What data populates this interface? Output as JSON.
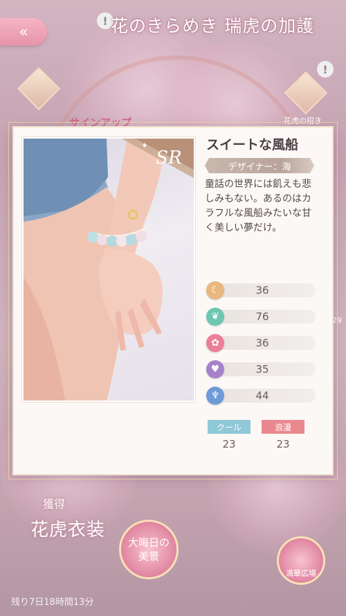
{
  "header": {
    "event_title": "花のきらめき 瑞虎の加護",
    "back_label": "«",
    "alert_glyph": "!"
  },
  "background": {
    "signup_tab": "サインアップ",
    "right_tab": "花虎の招き",
    "bottom_left_title": "花虎衣装",
    "bottom_left_sub": "獲得",
    "center_badge": "大晦日の美景",
    "right_badge": "満華広場",
    "timer": "残り7日18時間13分",
    "side_number": "29"
  },
  "card": {
    "rarity": "SR",
    "name": "スイートな風船",
    "designer": "デザイナー：海",
    "description": "童話の世界には飢えも悲しみもない。あるのはカラフルな風船みたいな甘く美しい夢だけ。",
    "stats": [
      {
        "icon": "moon-crest-icon",
        "color": "#e9b77f",
        "value": "36"
      },
      {
        "icon": "leaf-crest-icon",
        "color": "#6cc7b0",
        "value": "76"
      },
      {
        "icon": "flower-crest-icon",
        "color": "#ec7f97",
        "value": "36"
      },
      {
        "icon": "heart-crest-icon",
        "color": "#a781cc",
        "value": "35"
      },
      {
        "icon": "pillar-crest-icon",
        "color": "#6f9ad8",
        "value": "44"
      }
    ],
    "tags": [
      {
        "label": "クール",
        "color": "#8fc8d7",
        "value": "23"
      },
      {
        "label": "浪漫",
        "color": "#e9898f",
        "value": "23"
      }
    ]
  }
}
